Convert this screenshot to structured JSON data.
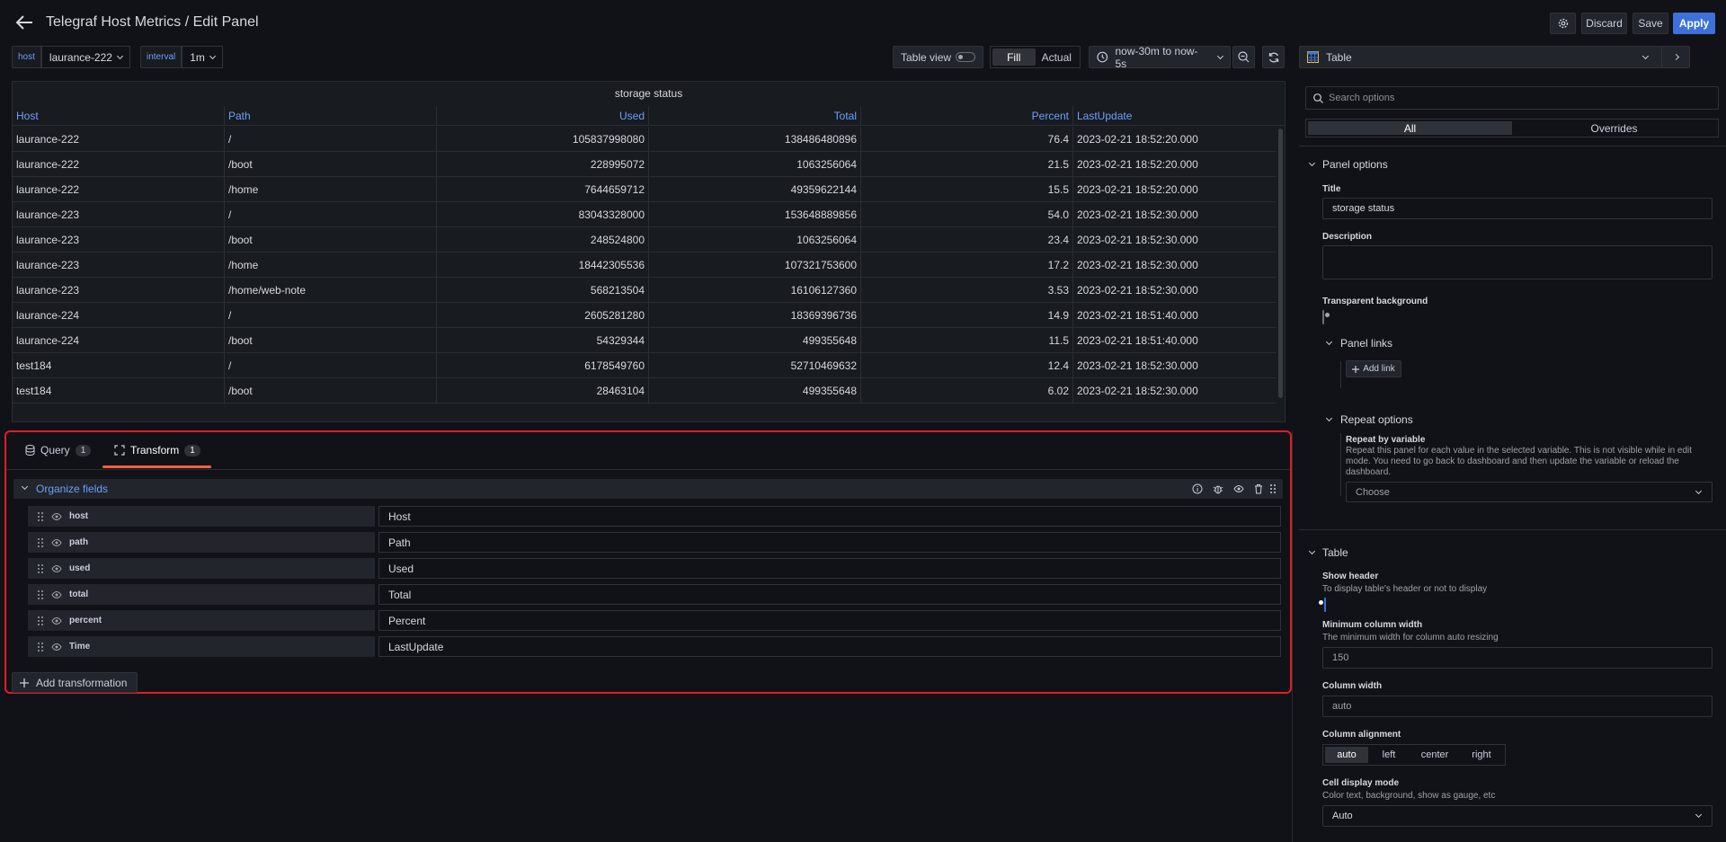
{
  "header": {
    "title": "Telegraf Host Metrics / Edit Panel",
    "discard_label": "Discard",
    "save_label": "Save",
    "apply_label": "Apply"
  },
  "variables": [
    {
      "label": "host",
      "value": "laurance-222"
    },
    {
      "label": "interval",
      "value": "1m"
    }
  ],
  "viz_toolbar": {
    "table_view_label": "Table view",
    "fill_label": "Fill",
    "actual_label": "Actual",
    "time_range": "now-30m to now-5s"
  },
  "panel": {
    "title": "storage status",
    "columns": [
      "Host",
      "Path",
      "Used",
      "Total",
      "Percent",
      "LastUpdate"
    ],
    "rows": [
      [
        "laurance-222",
        "/",
        "105837998080",
        "138486480896",
        "76.4",
        "2023-02-21 18:52:20.000"
      ],
      [
        "laurance-222",
        "/boot",
        "228995072",
        "1063256064",
        "21.5",
        "2023-02-21 18:52:20.000"
      ],
      [
        "laurance-222",
        "/home",
        "7644659712",
        "49359622144",
        "15.5",
        "2023-02-21 18:52:20.000"
      ],
      [
        "laurance-223",
        "/",
        "83043328000",
        "153648889856",
        "54.0",
        "2023-02-21 18:52:30.000"
      ],
      [
        "laurance-223",
        "/boot",
        "248524800",
        "1063256064",
        "23.4",
        "2023-02-21 18:52:30.000"
      ],
      [
        "laurance-223",
        "/home",
        "18442305536",
        "107321753600",
        "17.2",
        "2023-02-21 18:52:30.000"
      ],
      [
        "laurance-223",
        "/home/web-note",
        "568213504",
        "16106127360",
        "3.53",
        "2023-02-21 18:52:30.000"
      ],
      [
        "laurance-224",
        "/",
        "2605281280",
        "18369396736",
        "14.9",
        "2023-02-21 18:51:40.000"
      ],
      [
        "laurance-224",
        "/boot",
        "54329344",
        "499355648",
        "11.5",
        "2023-02-21 18:51:40.000"
      ],
      [
        "test184",
        "/",
        "6178549760",
        "52710469632",
        "12.4",
        "2023-02-21 18:52:30.000"
      ],
      [
        "test184",
        "/boot",
        "28463104",
        "499355648",
        "6.02",
        "2023-02-21 18:52:30.000"
      ]
    ]
  },
  "tabs": [
    {
      "label": "Query",
      "count": "1"
    },
    {
      "label": "Transform",
      "count": "1"
    }
  ],
  "transform": {
    "title": "Organize fields",
    "fields": [
      {
        "name": "host",
        "rename": "Host"
      },
      {
        "name": "path",
        "rename": "Path"
      },
      {
        "name": "used",
        "rename": "Used"
      },
      {
        "name": "total",
        "rename": "Total"
      },
      {
        "name": "percent",
        "rename": "Percent"
      },
      {
        "name": "Time",
        "rename": "LastUpdate"
      }
    ],
    "add_label": "Add transformation"
  },
  "options": {
    "viz_type": "Table",
    "search_placeholder": "Search options",
    "tab_all": "All",
    "tab_overrides": "Overrides",
    "panel_options_title": "Panel options",
    "title_label": "Title",
    "title_value": "storage status",
    "description_label": "Description",
    "transparent_label": "Transparent background",
    "panel_links_title": "Panel links",
    "add_link_label": "Add link",
    "repeat_options_title": "Repeat options",
    "repeat_by_label": "Repeat by variable",
    "repeat_by_desc": "Repeat this panel for each value in the selected variable. This is not visible while in edit mode. You need to go back to dashboard and then update the variable or reload the dashboard.",
    "repeat_choose": "Choose",
    "table_title": "Table",
    "show_header_label": "Show header",
    "show_header_desc": "To display table's header or not to display",
    "min_col_width_label": "Minimum column width",
    "min_col_width_desc": "The minimum width for column auto resizing",
    "min_col_width_value": "150",
    "col_width_label": "Column width",
    "col_width_placeholder": "auto",
    "col_align_label": "Column alignment",
    "col_align_options": [
      "auto",
      "left",
      "center",
      "right"
    ],
    "cell_display_label": "Cell display mode",
    "cell_display_desc": "Color text, background, show as gauge, etc",
    "cell_display_value": "Auto"
  },
  "colors": {
    "accent": "#3d71d9",
    "link_blue": "#6e9fff",
    "highlight_red": "#e11d24",
    "tab_underline": "#f55f3e"
  }
}
